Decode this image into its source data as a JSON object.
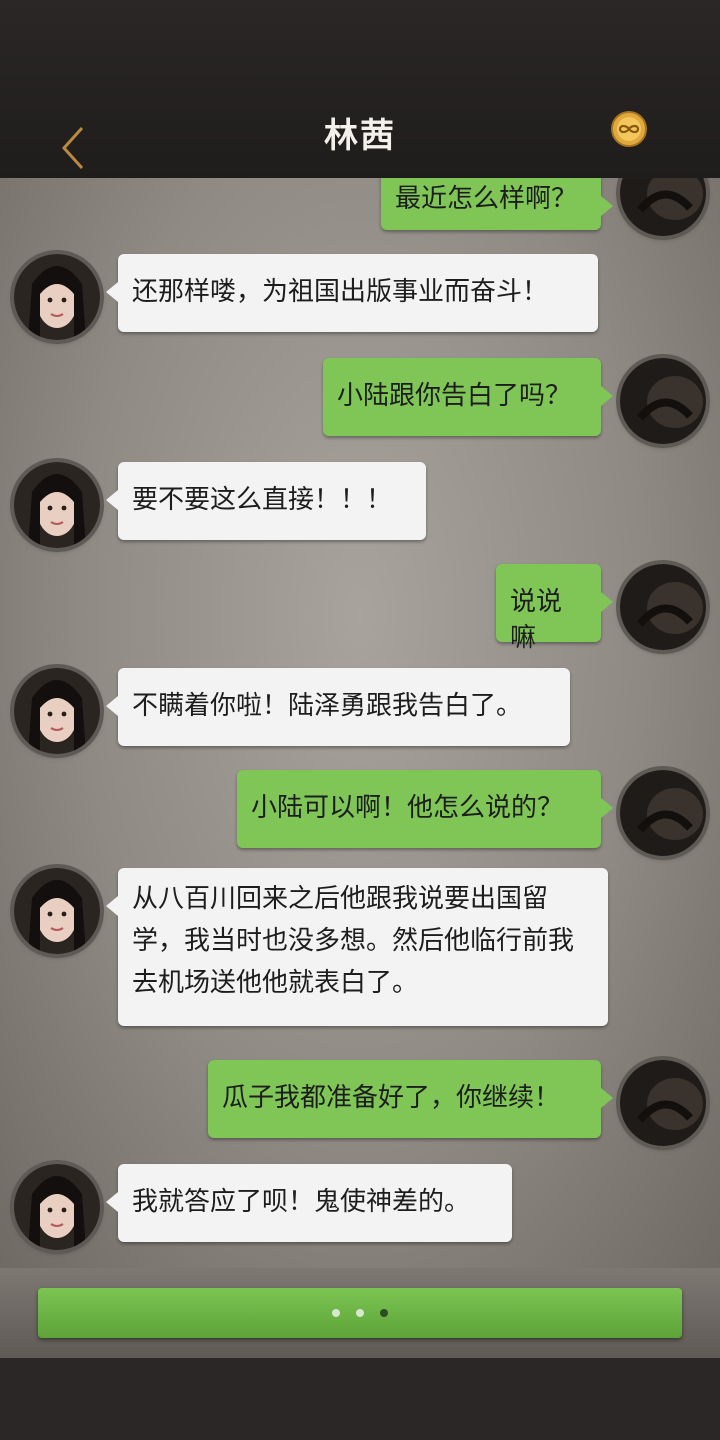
{
  "header": {
    "title": "林茜"
  },
  "messages": [
    {
      "side": "right",
      "text": "最近怎么样啊？"
    },
    {
      "side": "left",
      "text": "还那样喽，为祖国出版事业而奋斗！"
    },
    {
      "side": "right",
      "text": "小陆跟你告白了吗？"
    },
    {
      "side": "left",
      "text": "要不要这么直接！！！"
    },
    {
      "side": "right",
      "text": "说说嘛"
    },
    {
      "side": "left",
      "text": "不瞒着你啦！陆泽勇跟我告白了。"
    },
    {
      "side": "right",
      "text": "小陆可以啊！他怎么说的？"
    },
    {
      "side": "left",
      "text": "从八百川回来之后他跟我说要出国留学，我当时也没多想。然后他临行前我去机场送他他就表白了。"
    },
    {
      "side": "right",
      "text": "瓜子我都准备好了，你继续！"
    },
    {
      "side": "left",
      "text": "我就答应了呗！鬼使神差的。"
    }
  ],
  "reply_bar": {
    "dots": 3,
    "active_dot": 3
  },
  "colors": {
    "own_bubble": "#7fc657",
    "other_bubble": "#f3f3f3",
    "accent": "#c89a4a"
  }
}
